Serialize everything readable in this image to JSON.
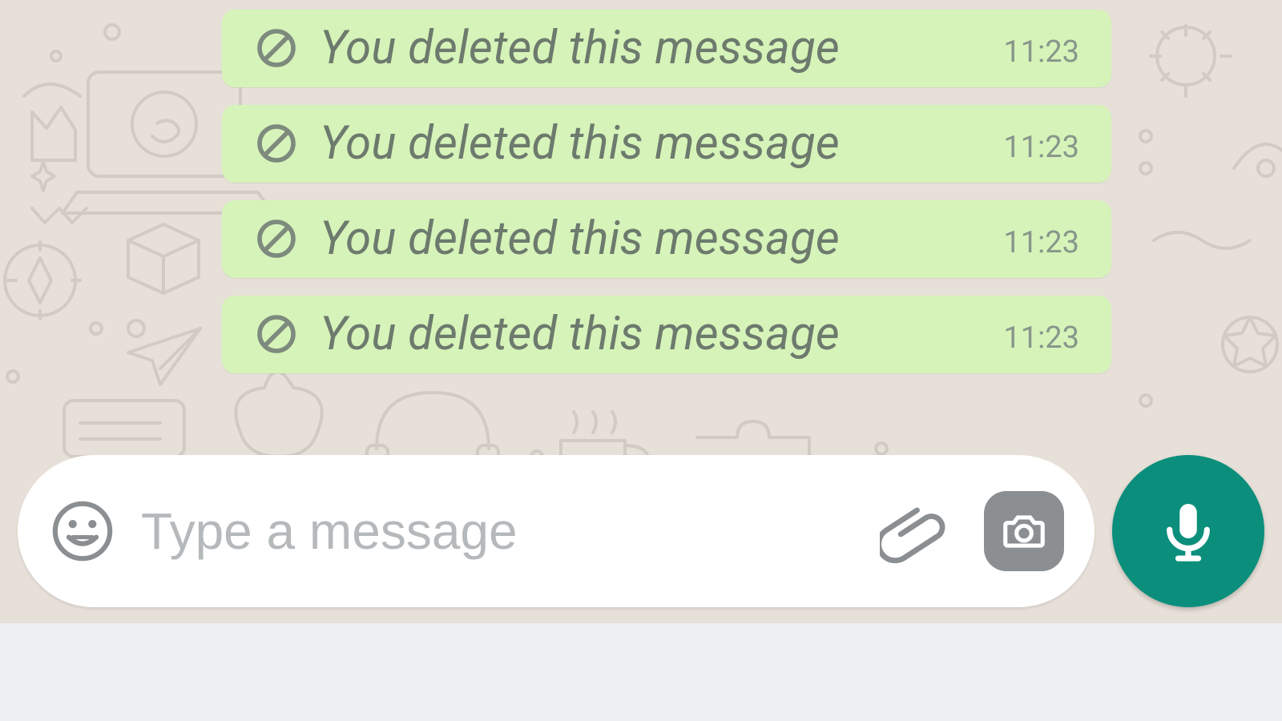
{
  "messages": [
    {
      "text": "You deleted this message",
      "time": "11:23"
    },
    {
      "text": "You deleted this message",
      "time": "11:23"
    },
    {
      "text": "You deleted this message",
      "time": "11:23"
    },
    {
      "text": "You deleted this message",
      "time": "11:23"
    }
  ],
  "composer": {
    "placeholder": "Type a message",
    "value": ""
  },
  "colors": {
    "bubble_bg": "#d6f3b9",
    "bubble_text": "#6d7a6d",
    "timestamp": "#88968a",
    "icon_grey": "#8b8f92",
    "mic_fab": "#0b8f7c",
    "chat_bg": "#e7e0d8"
  },
  "icons": {
    "deleted": "prohibited-icon",
    "emoji": "emoji-smile-icon",
    "attach": "paperclip-icon",
    "camera": "camera-icon",
    "mic": "microphone-icon"
  }
}
